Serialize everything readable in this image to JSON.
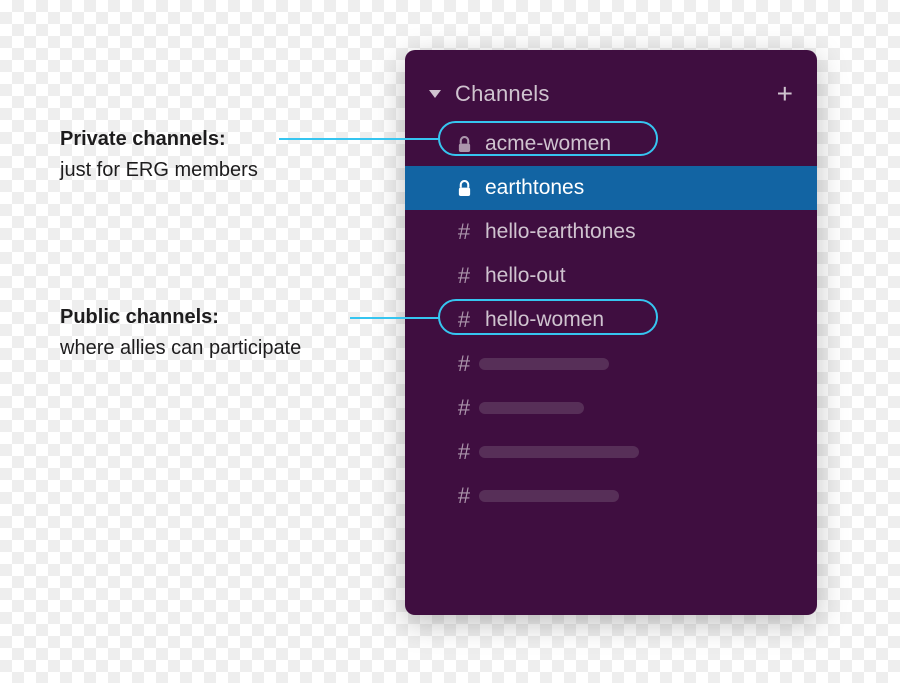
{
  "sidebar": {
    "section_title": "Channels",
    "channels": [
      {
        "name": "acme-women",
        "private": true,
        "selected": false
      },
      {
        "name": "earthtones",
        "private": true,
        "selected": true
      },
      {
        "name": "hello-earthtones",
        "private": false,
        "selected": false
      },
      {
        "name": "hello-out",
        "private": false,
        "selected": false
      },
      {
        "name": "hello-women",
        "private": false,
        "selected": false
      }
    ],
    "placeholder_count": 4
  },
  "callouts": {
    "private": {
      "heading": "Private channels:",
      "body": "just for ERG members"
    },
    "public": {
      "heading": "Public channels:",
      "body": "where allies can participate"
    }
  },
  "colors": {
    "sidebar_bg": "#3f0e40",
    "selected_bg": "#1264a3",
    "accent": "#36c5f0"
  }
}
